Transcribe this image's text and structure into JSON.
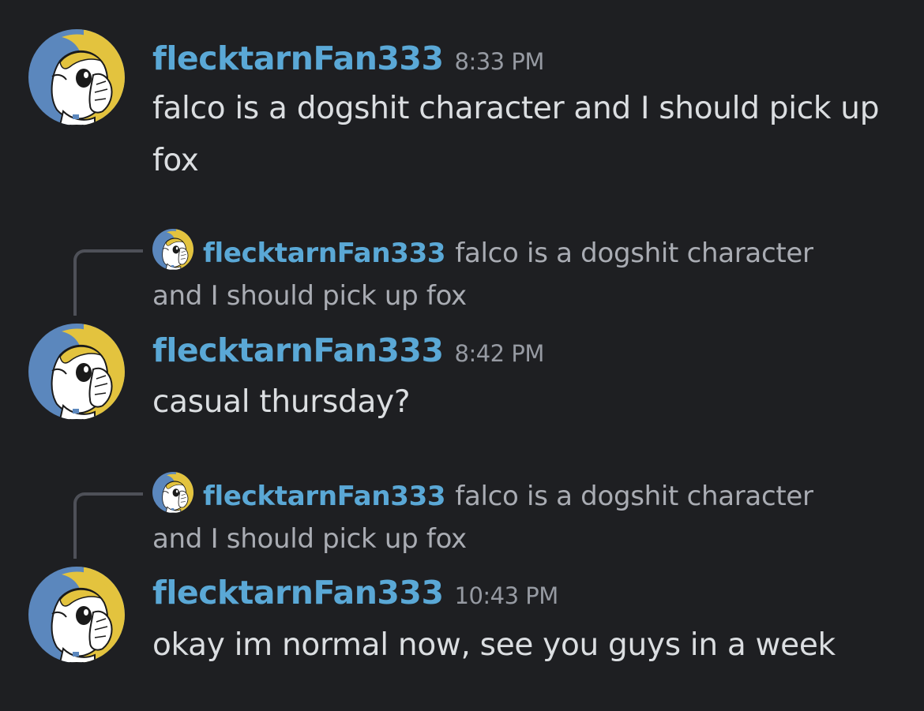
{
  "messages": [
    {
      "username": "flecktarnFan333",
      "time": "8:33 PM",
      "text": "falco is a dogshit character and I should pick up fox"
    },
    {
      "reply": {
        "username": "flecktarnFan333",
        "text": "falco is a dogshit character and I should pick up fox"
      },
      "username": "flecktarnFan333",
      "time": "8:42 PM",
      "text": "casual thursday?"
    },
    {
      "reply": {
        "username": "flecktarnFan333",
        "text": "falco is a dogshit character and I should pick up fox"
      },
      "username": "flecktarnFan333",
      "time": "10:43 PM",
      "text": "okay im normal now, see you guys in a week"
    }
  ],
  "colors": {
    "background": "#1e1f22",
    "username": "#5aa8d6",
    "message_text": "#dbdee1",
    "timestamp": "#969aa2",
    "avatar_blue": "#5b87bd",
    "avatar_yellow": "#e3c33e"
  },
  "icons": {
    "avatar": "anime-character-avatar-icon"
  }
}
